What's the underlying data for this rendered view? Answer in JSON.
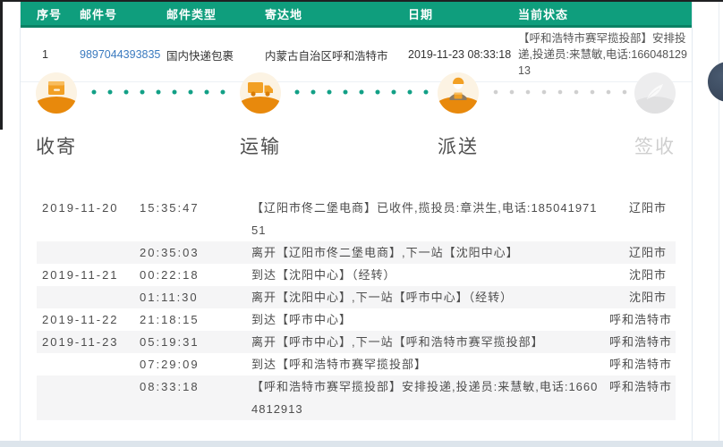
{
  "colors": {
    "header_green": "#0f9e7d",
    "header_green_dark": "#0a8164",
    "accent_orange": "#e8890c",
    "glyph_orange": "#f2a024",
    "circle_cream": "#fcf3e3",
    "dot_active_teal": "#12a086",
    "dot_inactive_gray": "#cfcfcf",
    "link_blue": "#3a7abf",
    "row_alt_gray": "#f5f5f6",
    "floating_button_dark": "#38465a"
  },
  "results": {
    "headers": [
      "序号",
      "邮件号",
      "邮件类型",
      "寄达地",
      "日期",
      "当前状态"
    ],
    "row": {
      "index": "1",
      "mail_no": "9897044393835",
      "mail_type": "国内快递包裹",
      "destination": "内蒙古自治区呼和浩特市",
      "date": "2019-11-23 08:33:18",
      "status": "【呼和浩特市赛罕揽投部】安排投递,投递员:来慧敏,电话:16604812913"
    }
  },
  "progress": {
    "steps": [
      {
        "label": "收寄",
        "icon": "parcel-icon",
        "state": "active"
      },
      {
        "label": "运输",
        "icon": "truck-icon",
        "state": "active"
      },
      {
        "label": "派送",
        "icon": "courier-icon",
        "state": "active"
      },
      {
        "label": "签收",
        "icon": "signature-icon",
        "state": "inactive"
      }
    ]
  },
  "events": [
    {
      "date": "2019-11-20",
      "time": "15:35:47",
      "desc": "【辽阳市佟二堡电商】已收件,揽投员:章洪生,电话:18504197151",
      "location": "辽阳市"
    },
    {
      "date": "",
      "time": "20:35:03",
      "desc": "离开【辽阳市佟二堡电商】,下一站【沈阳中心】",
      "location": "辽阳市"
    },
    {
      "date": "2019-11-21",
      "time": "00:22:18",
      "desc": "到达【沈阳中心】（经转）",
      "location": "沈阳市"
    },
    {
      "date": "",
      "time": "01:11:30",
      "desc": "离开【沈阳中心】,下一站【呼市中心】（经转）",
      "location": "沈阳市"
    },
    {
      "date": "2019-11-22",
      "time": "21:18:15",
      "desc": "到达【呼市中心】",
      "location": "呼和浩特市"
    },
    {
      "date": "2019-11-23",
      "time": "05:19:31",
      "desc": "离开【呼市中心】,下一站【呼和浩特市赛罕揽投部】",
      "location": "呼和浩特市"
    },
    {
      "date": "",
      "time": "07:29:09",
      "desc": "到达【呼和浩特市赛罕揽投部】",
      "location": "呼和浩特市"
    },
    {
      "date": "",
      "time": "08:33:18",
      "desc": "【呼和浩特市赛罕揽投部】安排投递,投递员:来慧敏,电话:16604812913",
      "location": "呼和浩特市"
    }
  ]
}
